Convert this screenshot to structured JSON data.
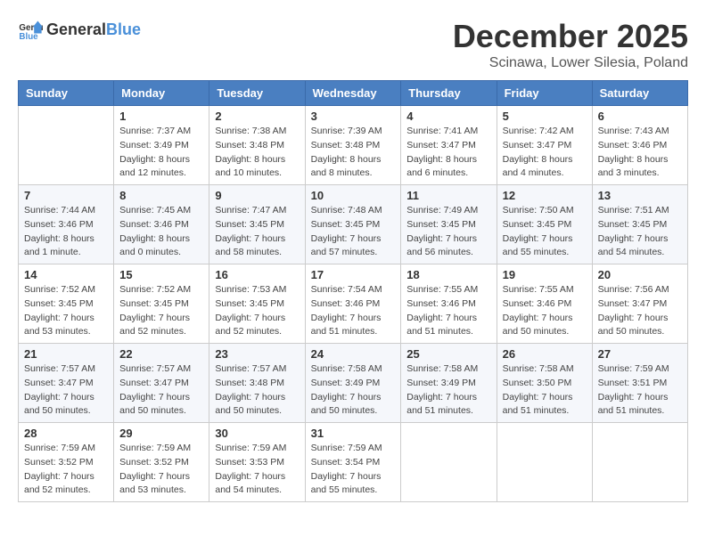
{
  "header": {
    "logo_general": "General",
    "logo_blue": "Blue",
    "month": "December 2025",
    "location": "Scinawa, Lower Silesia, Poland"
  },
  "weekdays": [
    "Sunday",
    "Monday",
    "Tuesday",
    "Wednesday",
    "Thursday",
    "Friday",
    "Saturday"
  ],
  "weeks": [
    [
      {
        "day": "",
        "info": ""
      },
      {
        "day": "1",
        "info": "Sunrise: 7:37 AM\nSunset: 3:49 PM\nDaylight: 8 hours\nand 12 minutes."
      },
      {
        "day": "2",
        "info": "Sunrise: 7:38 AM\nSunset: 3:48 PM\nDaylight: 8 hours\nand 10 minutes."
      },
      {
        "day": "3",
        "info": "Sunrise: 7:39 AM\nSunset: 3:48 PM\nDaylight: 8 hours\nand 8 minutes."
      },
      {
        "day": "4",
        "info": "Sunrise: 7:41 AM\nSunset: 3:47 PM\nDaylight: 8 hours\nand 6 minutes."
      },
      {
        "day": "5",
        "info": "Sunrise: 7:42 AM\nSunset: 3:47 PM\nDaylight: 8 hours\nand 4 minutes."
      },
      {
        "day": "6",
        "info": "Sunrise: 7:43 AM\nSunset: 3:46 PM\nDaylight: 8 hours\nand 3 minutes."
      }
    ],
    [
      {
        "day": "7",
        "info": "Sunrise: 7:44 AM\nSunset: 3:46 PM\nDaylight: 8 hours\nand 1 minute."
      },
      {
        "day": "8",
        "info": "Sunrise: 7:45 AM\nSunset: 3:46 PM\nDaylight: 8 hours\nand 0 minutes."
      },
      {
        "day": "9",
        "info": "Sunrise: 7:47 AM\nSunset: 3:45 PM\nDaylight: 7 hours\nand 58 minutes."
      },
      {
        "day": "10",
        "info": "Sunrise: 7:48 AM\nSunset: 3:45 PM\nDaylight: 7 hours\nand 57 minutes."
      },
      {
        "day": "11",
        "info": "Sunrise: 7:49 AM\nSunset: 3:45 PM\nDaylight: 7 hours\nand 56 minutes."
      },
      {
        "day": "12",
        "info": "Sunrise: 7:50 AM\nSunset: 3:45 PM\nDaylight: 7 hours\nand 55 minutes."
      },
      {
        "day": "13",
        "info": "Sunrise: 7:51 AM\nSunset: 3:45 PM\nDaylight: 7 hours\nand 54 minutes."
      }
    ],
    [
      {
        "day": "14",
        "info": "Sunrise: 7:52 AM\nSunset: 3:45 PM\nDaylight: 7 hours\nand 53 minutes."
      },
      {
        "day": "15",
        "info": "Sunrise: 7:52 AM\nSunset: 3:45 PM\nDaylight: 7 hours\nand 52 minutes."
      },
      {
        "day": "16",
        "info": "Sunrise: 7:53 AM\nSunset: 3:45 PM\nDaylight: 7 hours\nand 52 minutes."
      },
      {
        "day": "17",
        "info": "Sunrise: 7:54 AM\nSunset: 3:46 PM\nDaylight: 7 hours\nand 51 minutes."
      },
      {
        "day": "18",
        "info": "Sunrise: 7:55 AM\nSunset: 3:46 PM\nDaylight: 7 hours\nand 51 minutes."
      },
      {
        "day": "19",
        "info": "Sunrise: 7:55 AM\nSunset: 3:46 PM\nDaylight: 7 hours\nand 50 minutes."
      },
      {
        "day": "20",
        "info": "Sunrise: 7:56 AM\nSunset: 3:47 PM\nDaylight: 7 hours\nand 50 minutes."
      }
    ],
    [
      {
        "day": "21",
        "info": "Sunrise: 7:57 AM\nSunset: 3:47 PM\nDaylight: 7 hours\nand 50 minutes."
      },
      {
        "day": "22",
        "info": "Sunrise: 7:57 AM\nSunset: 3:47 PM\nDaylight: 7 hours\nand 50 minutes."
      },
      {
        "day": "23",
        "info": "Sunrise: 7:57 AM\nSunset: 3:48 PM\nDaylight: 7 hours\nand 50 minutes."
      },
      {
        "day": "24",
        "info": "Sunrise: 7:58 AM\nSunset: 3:49 PM\nDaylight: 7 hours\nand 50 minutes."
      },
      {
        "day": "25",
        "info": "Sunrise: 7:58 AM\nSunset: 3:49 PM\nDaylight: 7 hours\nand 51 minutes."
      },
      {
        "day": "26",
        "info": "Sunrise: 7:58 AM\nSunset: 3:50 PM\nDaylight: 7 hours\nand 51 minutes."
      },
      {
        "day": "27",
        "info": "Sunrise: 7:59 AM\nSunset: 3:51 PM\nDaylight: 7 hours\nand 51 minutes."
      }
    ],
    [
      {
        "day": "28",
        "info": "Sunrise: 7:59 AM\nSunset: 3:52 PM\nDaylight: 7 hours\nand 52 minutes."
      },
      {
        "day": "29",
        "info": "Sunrise: 7:59 AM\nSunset: 3:52 PM\nDaylight: 7 hours\nand 53 minutes."
      },
      {
        "day": "30",
        "info": "Sunrise: 7:59 AM\nSunset: 3:53 PM\nDaylight: 7 hours\nand 54 minutes."
      },
      {
        "day": "31",
        "info": "Sunrise: 7:59 AM\nSunset: 3:54 PM\nDaylight: 7 hours\nand 55 minutes."
      },
      {
        "day": "",
        "info": ""
      },
      {
        "day": "",
        "info": ""
      },
      {
        "day": "",
        "info": ""
      }
    ]
  ]
}
